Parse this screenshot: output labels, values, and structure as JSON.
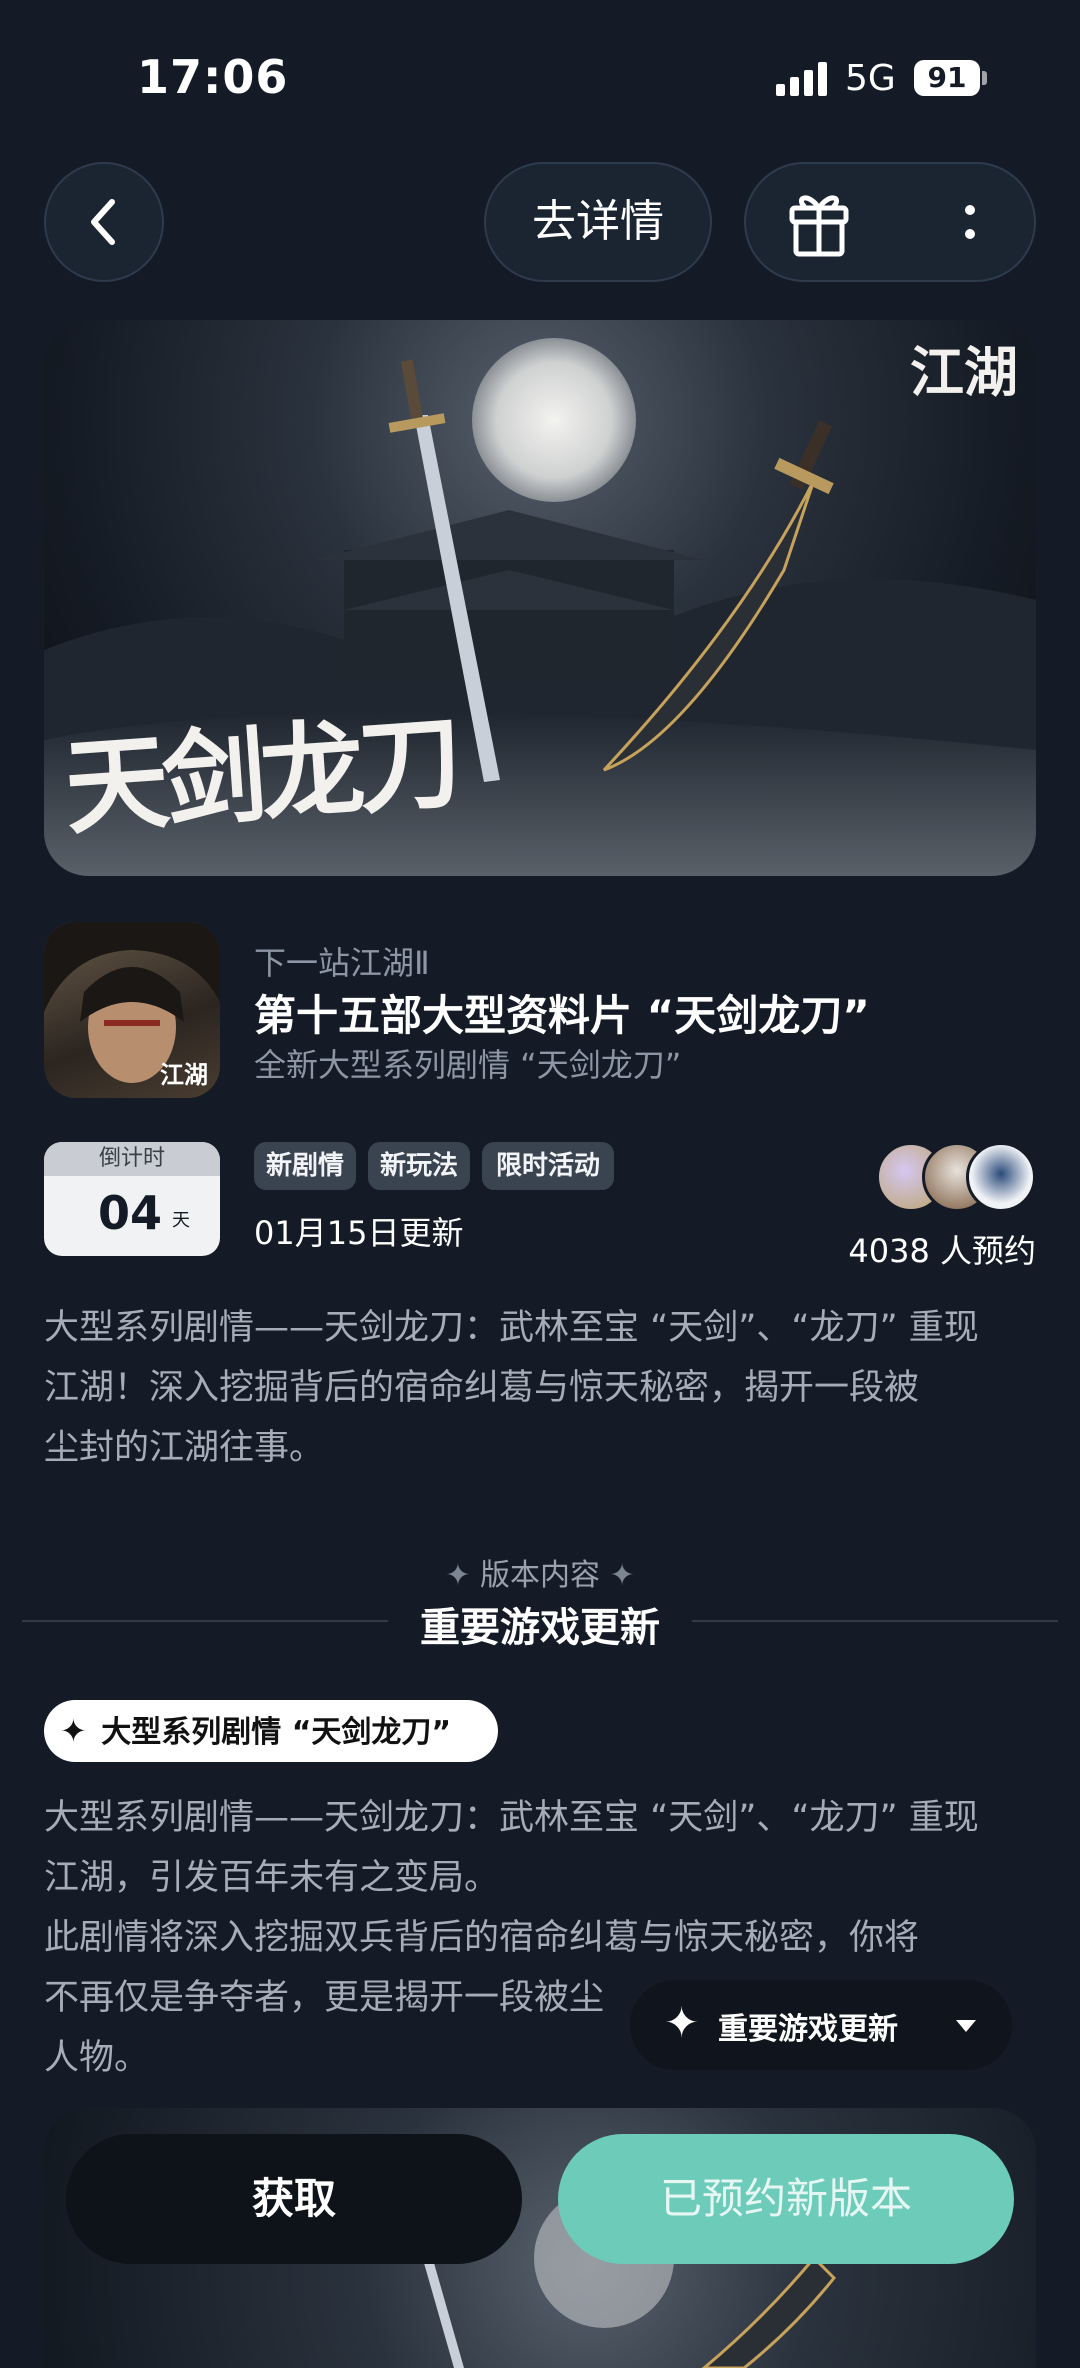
{
  "status_bar": {
    "time": "17:06",
    "network": "5G",
    "battery": "91"
  },
  "nav": {
    "details_label": "去详情"
  },
  "banner": {
    "title_art": "天剑龙刀",
    "logo": "江湖"
  },
  "game": {
    "name": "下一站江湖Ⅱ",
    "event_title": "第十五部大型资料片 “天剑龙刀”",
    "event_subtitle": "全新大型系列剧情 “天剑龙刀”",
    "icon_logo": "江湖"
  },
  "countdown": {
    "label": "倒计时",
    "value": "04",
    "unit": "天"
  },
  "tags": [
    "新剧情",
    "新玩法",
    "限时活动"
  ],
  "update_date": "01月15日更新",
  "reservations": "4038 人预约",
  "description": [
    "大型系列剧情——天剑龙刀：武林至宝 “天剑”、“龙刀” 重现",
    "江湖！深入挖掘背后的宿命纠葛与惊天秘密，揭开一段被",
    "尘封的江湖往事。"
  ],
  "version": {
    "label": "版本内容",
    "title": "重要游戏更新"
  },
  "chip": {
    "label": "大型系列剧情 “天剑龙刀”"
  },
  "body_text": [
    "大型系列剧情——天剑龙刀：武林至宝 “天剑”、“龙刀” 重现",
    "江湖，引发百年未有之变局。",
    "此剧情将深入挖掘双兵背后的宿命纠葛与惊天秘密，你将",
    "不再仅是争夺者，更是揭开一段被尘",
    "人物。"
  ],
  "floating_nav": {
    "label": "重要游戏更新"
  },
  "actions": {
    "get_label": "获取",
    "reserved_label": "已预约新版本"
  },
  "colors": {
    "background": "#141b26",
    "accent_teal": "#6ccbb9",
    "tag_bg": "#3a4350"
  }
}
